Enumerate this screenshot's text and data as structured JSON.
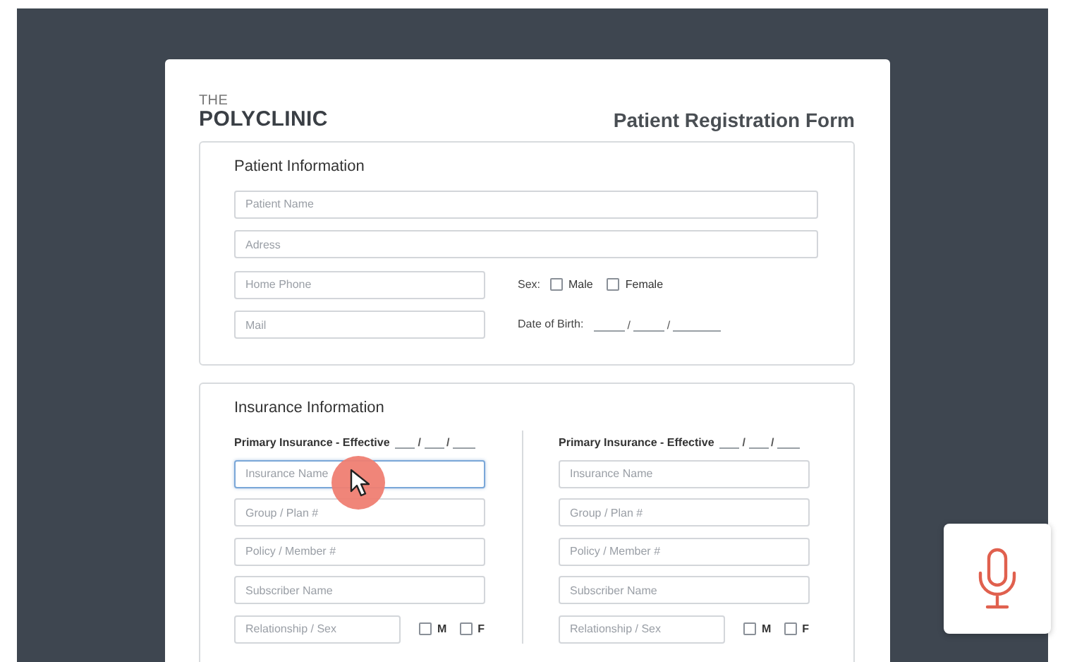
{
  "brand": {
    "small": "THE",
    "name": "POLYCLINIC"
  },
  "form_title": "Patient Registration Form",
  "patient_section": {
    "title": "Patient Information",
    "fields": [
      {
        "placeholder": "Patient Name",
        "kind": "wide"
      },
      {
        "placeholder": "Adress",
        "kind": "wide"
      },
      {
        "placeholder": "Home Phone",
        "kind": "half"
      },
      {
        "placeholder": "Mail",
        "kind": "half"
      }
    ],
    "sex": {
      "label": "Sex:",
      "options": [
        {
          "label": "Male",
          "checked": false
        },
        {
          "label": "Female",
          "checked": false
        }
      ]
    },
    "birth_date": {
      "label": "Date of Birth:",
      "separators": [
        "/",
        "/"
      ]
    }
  },
  "insurance_section": {
    "title": "Insurance Information",
    "columns": [
      {
        "heading": "Primary Insurance - Effective",
        "separators": [
          "/",
          "/"
        ],
        "fields": [
          {
            "placeholder": "Insurance Name",
            "focused": true
          },
          {
            "placeholder": "Group / Plan #",
            "focused": false
          },
          {
            "placeholder": "Policy / Member #",
            "focused": false
          },
          {
            "placeholder": "Subscriber Name",
            "focused": false
          }
        ],
        "relationship": {
          "placeholder": "Relationship / Sex",
          "options": [
            {
              "label": "M",
              "checked": false
            },
            {
              "label": "F",
              "checked": false
            }
          ]
        }
      },
      {
        "heading": "Primary Insurance - Effective",
        "separators": [
          "/",
          "/"
        ],
        "fields": [
          {
            "placeholder": "Insurance Name",
            "focused": false
          },
          {
            "placeholder": "Group / Plan #",
            "focused": false
          },
          {
            "placeholder": "Policy / Member #",
            "focused": false
          },
          {
            "placeholder": "Subscriber Name",
            "focused": false
          }
        ],
        "relationship": {
          "placeholder": "Relationship / Sex",
          "options": [
            {
              "label": "M",
              "checked": false
            },
            {
              "label": "F",
              "checked": false
            }
          ]
        }
      }
    ]
  }
}
